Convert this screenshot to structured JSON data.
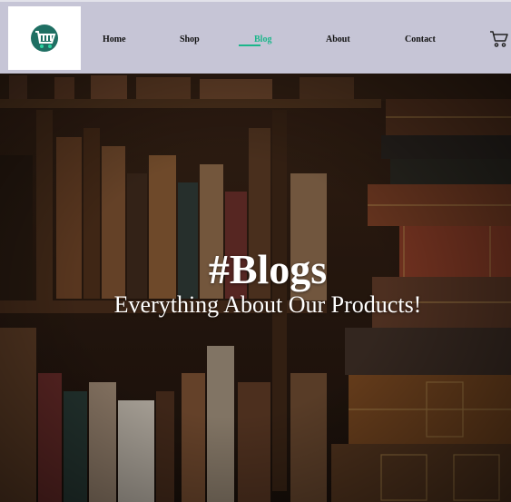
{
  "header": {
    "logo_icon": "shopping-cart-logo-icon",
    "cart_icon": "cart-icon"
  },
  "nav": {
    "items": [
      {
        "label": "Home"
      },
      {
        "label": "Shop"
      },
      {
        "label": "Blog",
        "active": true
      },
      {
        "label": "About"
      },
      {
        "label": "Contact"
      }
    ]
  },
  "hero": {
    "title": "#Blogs",
    "subtitle": "Everything About Our Products!"
  },
  "colors": {
    "header_bg": "#c6c5d6",
    "accent": "#1bb68a",
    "hero_text": "#ffffff"
  }
}
